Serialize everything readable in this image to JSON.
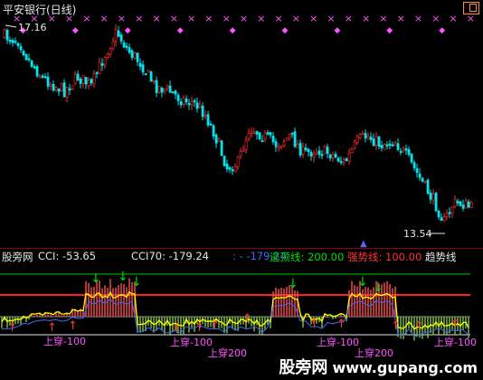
{
  "window": {
    "title": "平安银行(日线)"
  },
  "main": {
    "high_label": "17.16",
    "low_label": "13.54"
  },
  "indicator": {
    "name": "股旁网",
    "cci": "CCI: -53.65",
    "cci70": "CCI70: -179.24",
    "dash": ": -  -179.24",
    "top_line": "逃顶线: 200.00",
    "strong_line": "强势线: 100.00",
    "trend_line": "趋势线",
    "signals": [
      "上穿-100",
      "上穿-100",
      "上穿200",
      "上穿-100",
      "上穿200",
      "上穿-100"
    ]
  },
  "watermark": {
    "site": "股旁网",
    "url": "www.gupang.com"
  },
  "colors": {
    "up": "#ff3030",
    "down": "#00e5ee",
    "marker": "#ff55ff",
    "arrow_down": "#00dd00",
    "arrow_up": "#ff3030",
    "yellow_line": "#ffff00",
    "blue_line": "#4169ff"
  },
  "icons": [
    "max-window-icon",
    "sell-arrow-icon",
    "buy-arrow-icon",
    "pointer-arrow-icon"
  ]
}
